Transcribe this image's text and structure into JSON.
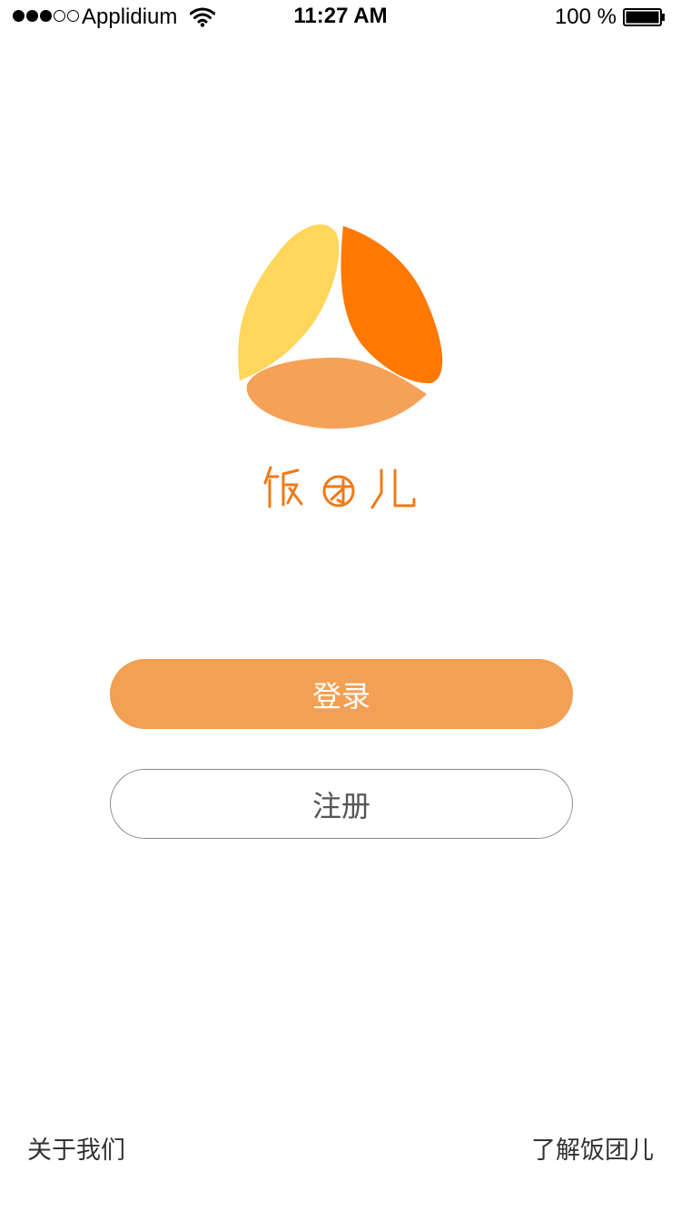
{
  "status_bar": {
    "carrier": "Applidium",
    "time": "11:27 AM",
    "battery_percent": "100 %",
    "signal_strength": 3,
    "signal_max": 5,
    "battery_level": 1.0
  },
  "brand": {
    "logo_name": "饭团儿",
    "colors": {
      "yellow": "#fed65b",
      "orange": "#ff7800",
      "light_orange": "#f5a157"
    }
  },
  "actions": {
    "login_label": "登录",
    "register_label": "注册"
  },
  "footer": {
    "about_label": "关于我们",
    "learn_label": "了解饭团儿"
  }
}
